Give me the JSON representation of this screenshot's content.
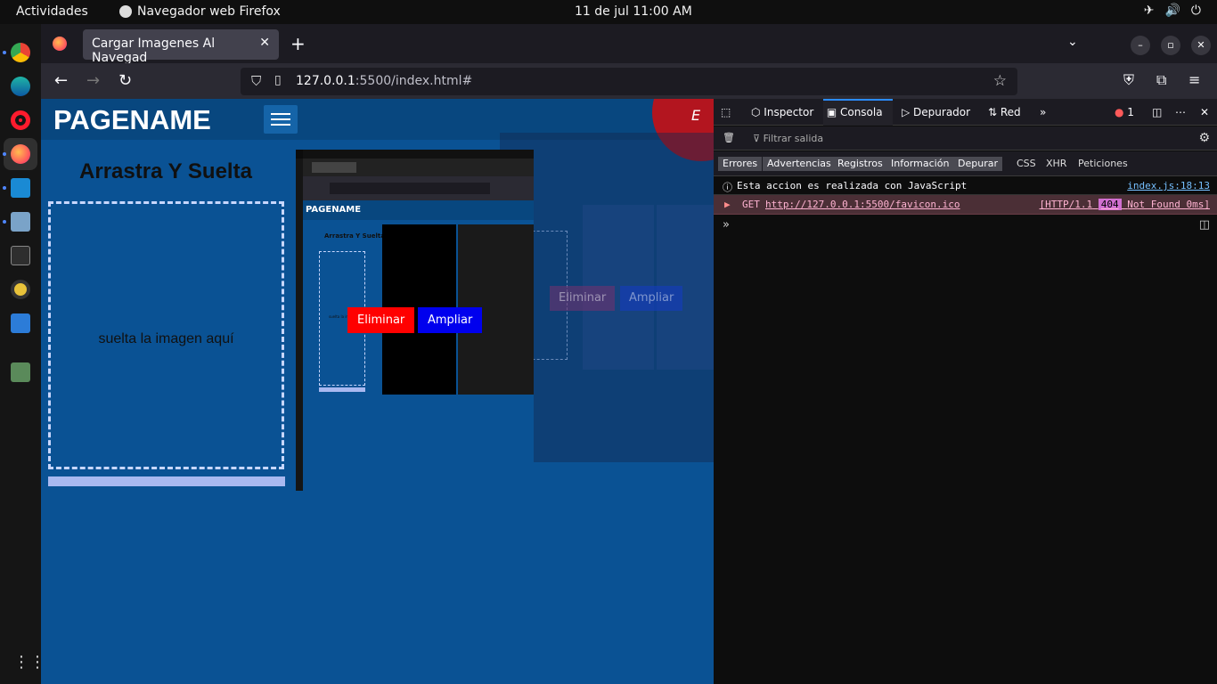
{
  "topbar": {
    "activities": "Actividades",
    "app_name": "Navegador web Firefox",
    "clock": "11 de jul  11:00 AM"
  },
  "browser": {
    "tab_title": "Cargar Imagenes Al Navegad",
    "url_host": "127.0.0.1",
    "url_path": ":5500/index.html#"
  },
  "page": {
    "brand": "PAGENAME",
    "heading": "Arrastra Y Suelta",
    "drop_text": "suelta la imagen aquí",
    "delete_button": "Eliminar",
    "zoom_button": "Ampliar",
    "corner_letter": "E",
    "mini": {
      "brand": "PAGENAME",
      "heading": "Arrastra Y Suelta",
      "drop_text": "suelta la imagen"
    }
  },
  "devtools": {
    "tabs": [
      "Inspector",
      "Consola",
      "Depurador",
      "Red"
    ],
    "error_count": "1",
    "filter_placeholder": "Filtrar salida",
    "categories": [
      "Errores",
      "Advertencias",
      "Registros",
      "Información",
      "Depurar"
    ],
    "extra_categories": [
      "CSS",
      "XHR",
      "Peticiones"
    ],
    "log_message": "Esta accion es realizada con JavaScript",
    "log_source": "index.js:18:13",
    "net_method": "GET",
    "net_url": "http://127.0.0.1:5500/favicon.ico",
    "net_proto": "[HTTP/1.1",
    "net_code": "404",
    "net_status": "Not Found 0ms]"
  },
  "colors": {
    "page_bg": "#0a5294",
    "delete": "#ff0000",
    "zoom": "#0000ee"
  }
}
